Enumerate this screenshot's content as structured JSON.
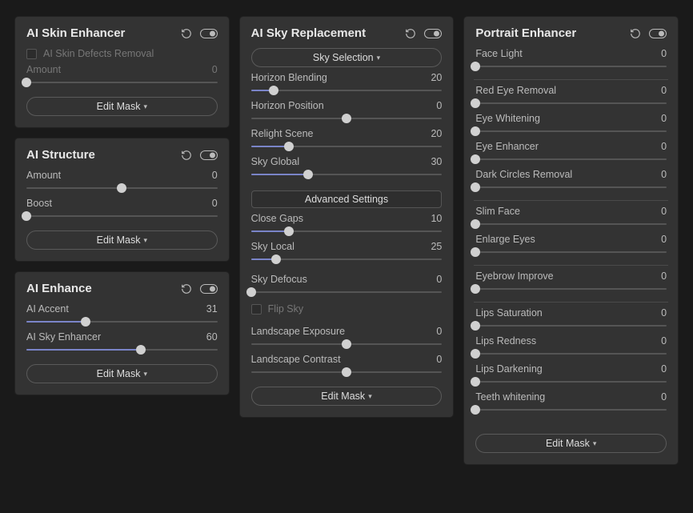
{
  "col1": {
    "panel1": {
      "title": "AI Skin Enhancer",
      "check1": "AI Skin Defects Removal",
      "s_amount": {
        "label": "Amount",
        "value": "0",
        "pos": 0
      },
      "editmask": "Edit Mask"
    },
    "panel2": {
      "title": "AI Structure",
      "s_amount": {
        "label": "Amount",
        "value": "0",
        "pos": 50
      },
      "s_boost": {
        "label": "Boost",
        "value": "0",
        "pos": 0
      },
      "editmask": "Edit Mask"
    },
    "panel3": {
      "title": "AI Enhance",
      "s_accent": {
        "label": "AI Accent",
        "value": "31",
        "pos": 31
      },
      "s_skyenh": {
        "label": "AI Sky Enhancer",
        "value": "60",
        "pos": 60
      },
      "editmask": "Edit Mask"
    }
  },
  "col2": {
    "panel1": {
      "title": "AI Sky Replacement",
      "skysel": "Sky Selection",
      "s_hb": {
        "label": "Horizon Blending",
        "value": "20",
        "pos": 12
      },
      "s_hp": {
        "label": "Horizon Position",
        "value": "0",
        "pos": 50
      },
      "s_rl": {
        "label": "Relight Scene",
        "value": "20",
        "pos": 20
      },
      "s_sg": {
        "label": "Sky Global",
        "value": "30",
        "pos": 30
      },
      "adv": "Advanced Settings",
      "s_cg": {
        "label": "Close Gaps",
        "value": "10",
        "pos": 20
      },
      "s_sl": {
        "label": "Sky Local",
        "value": "25",
        "pos": 13
      },
      "s_sd": {
        "label": "Sky Defocus",
        "value": "0",
        "pos": 0
      },
      "flip": "Flip Sky",
      "s_le": {
        "label": "Landscape Exposure",
        "value": "0",
        "pos": 50
      },
      "s_lc": {
        "label": "Landscape Contrast",
        "value": "0",
        "pos": 50
      },
      "editmask": "Edit Mask"
    }
  },
  "col3": {
    "panel1": {
      "title": "Portrait Enhancer",
      "s_fl": {
        "label": "Face Light",
        "value": "0",
        "pos": 0
      },
      "s_re": {
        "label": "Red Eye Removal",
        "value": "0",
        "pos": 0
      },
      "s_ew": {
        "label": "Eye Whitening",
        "value": "0",
        "pos": 0
      },
      "s_ee": {
        "label": "Eye Enhancer",
        "value": "0",
        "pos": 0
      },
      "s_dc": {
        "label": "Dark Circles Removal",
        "value": "0",
        "pos": 0
      },
      "s_sf": {
        "label": "Slim Face",
        "value": "0",
        "pos": 0
      },
      "s_el": {
        "label": "Enlarge Eyes",
        "value": "0",
        "pos": 0
      },
      "s_ei": {
        "label": "Eyebrow Improve",
        "value": "0",
        "pos": 0
      },
      "s_ls": {
        "label": "Lips Saturation",
        "value": "0",
        "pos": 0
      },
      "s_lr": {
        "label": "Lips Redness",
        "value": "0",
        "pos": 0
      },
      "s_ld": {
        "label": "Lips Darkening",
        "value": "0",
        "pos": 0
      },
      "s_tw": {
        "label": "Teeth whitening",
        "value": "0",
        "pos": 0
      },
      "editmask": "Edit Mask"
    }
  }
}
